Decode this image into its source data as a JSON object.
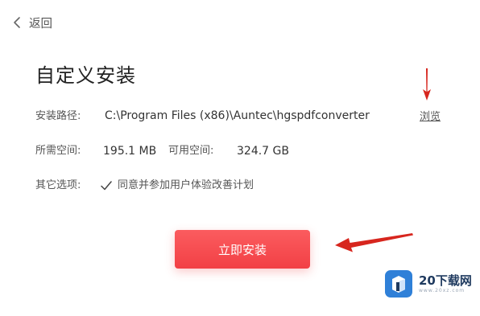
{
  "header": {
    "back_icon": "chevron-left-icon",
    "back_label": "返回"
  },
  "title": "自定义安装",
  "install_path": {
    "label": "安装路径:",
    "value": "C:\\Program Files (x86)\\Auntec\\hgspdfconverter",
    "browse_label": "浏览"
  },
  "space": {
    "required_label": "所需空间:",
    "required_value": "195.1 MB",
    "available_label": "可用空间:",
    "available_value": "324.7 GB"
  },
  "options": {
    "label": "其它选项:",
    "checkbox_checked": true,
    "checkbox_icon": "checkmark-icon",
    "checkbox_label": "同意并参加用户体验改善计划"
  },
  "install_button": {
    "label": "立即安装",
    "color": "#f24045"
  },
  "annotations": {
    "arrow_color": "#d7261e",
    "icons": [
      "arrow-down-icon",
      "arrow-left-icon"
    ]
  },
  "watermark": {
    "logo_icon": "box-logo-icon",
    "text": "20下载网",
    "url": "www.20xz.com"
  }
}
